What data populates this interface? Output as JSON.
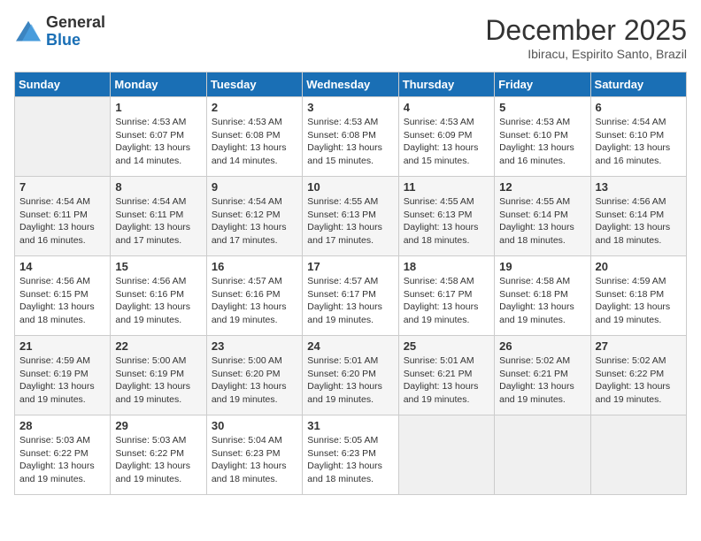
{
  "header": {
    "logo_general": "General",
    "logo_blue": "Blue",
    "month_year": "December 2025",
    "location": "Ibiracu, Espirito Santo, Brazil"
  },
  "weekdays": [
    "Sunday",
    "Monday",
    "Tuesday",
    "Wednesday",
    "Thursday",
    "Friday",
    "Saturday"
  ],
  "weeks": [
    [
      {
        "num": "",
        "sunrise": "",
        "sunset": "",
        "daylight": "",
        "empty": true
      },
      {
        "num": "1",
        "sunrise": "Sunrise: 4:53 AM",
        "sunset": "Sunset: 6:07 PM",
        "daylight": "Daylight: 13 hours and 14 minutes."
      },
      {
        "num": "2",
        "sunrise": "Sunrise: 4:53 AM",
        "sunset": "Sunset: 6:08 PM",
        "daylight": "Daylight: 13 hours and 14 minutes."
      },
      {
        "num": "3",
        "sunrise": "Sunrise: 4:53 AM",
        "sunset": "Sunset: 6:08 PM",
        "daylight": "Daylight: 13 hours and 15 minutes."
      },
      {
        "num": "4",
        "sunrise": "Sunrise: 4:53 AM",
        "sunset": "Sunset: 6:09 PM",
        "daylight": "Daylight: 13 hours and 15 minutes."
      },
      {
        "num": "5",
        "sunrise": "Sunrise: 4:53 AM",
        "sunset": "Sunset: 6:10 PM",
        "daylight": "Daylight: 13 hours and 16 minutes."
      },
      {
        "num": "6",
        "sunrise": "Sunrise: 4:54 AM",
        "sunset": "Sunset: 6:10 PM",
        "daylight": "Daylight: 13 hours and 16 minutes."
      }
    ],
    [
      {
        "num": "7",
        "sunrise": "Sunrise: 4:54 AM",
        "sunset": "Sunset: 6:11 PM",
        "daylight": "Daylight: 13 hours and 16 minutes."
      },
      {
        "num": "8",
        "sunrise": "Sunrise: 4:54 AM",
        "sunset": "Sunset: 6:11 PM",
        "daylight": "Daylight: 13 hours and 17 minutes."
      },
      {
        "num": "9",
        "sunrise": "Sunrise: 4:54 AM",
        "sunset": "Sunset: 6:12 PM",
        "daylight": "Daylight: 13 hours and 17 minutes."
      },
      {
        "num": "10",
        "sunrise": "Sunrise: 4:55 AM",
        "sunset": "Sunset: 6:13 PM",
        "daylight": "Daylight: 13 hours and 17 minutes."
      },
      {
        "num": "11",
        "sunrise": "Sunrise: 4:55 AM",
        "sunset": "Sunset: 6:13 PM",
        "daylight": "Daylight: 13 hours and 18 minutes."
      },
      {
        "num": "12",
        "sunrise": "Sunrise: 4:55 AM",
        "sunset": "Sunset: 6:14 PM",
        "daylight": "Daylight: 13 hours and 18 minutes."
      },
      {
        "num": "13",
        "sunrise": "Sunrise: 4:56 AM",
        "sunset": "Sunset: 6:14 PM",
        "daylight": "Daylight: 13 hours and 18 minutes."
      }
    ],
    [
      {
        "num": "14",
        "sunrise": "Sunrise: 4:56 AM",
        "sunset": "Sunset: 6:15 PM",
        "daylight": "Daylight: 13 hours and 18 minutes."
      },
      {
        "num": "15",
        "sunrise": "Sunrise: 4:56 AM",
        "sunset": "Sunset: 6:16 PM",
        "daylight": "Daylight: 13 hours and 19 minutes."
      },
      {
        "num": "16",
        "sunrise": "Sunrise: 4:57 AM",
        "sunset": "Sunset: 6:16 PM",
        "daylight": "Daylight: 13 hours and 19 minutes."
      },
      {
        "num": "17",
        "sunrise": "Sunrise: 4:57 AM",
        "sunset": "Sunset: 6:17 PM",
        "daylight": "Daylight: 13 hours and 19 minutes."
      },
      {
        "num": "18",
        "sunrise": "Sunrise: 4:58 AM",
        "sunset": "Sunset: 6:17 PM",
        "daylight": "Daylight: 13 hours and 19 minutes."
      },
      {
        "num": "19",
        "sunrise": "Sunrise: 4:58 AM",
        "sunset": "Sunset: 6:18 PM",
        "daylight": "Daylight: 13 hours and 19 minutes."
      },
      {
        "num": "20",
        "sunrise": "Sunrise: 4:59 AM",
        "sunset": "Sunset: 6:18 PM",
        "daylight": "Daylight: 13 hours and 19 minutes."
      }
    ],
    [
      {
        "num": "21",
        "sunrise": "Sunrise: 4:59 AM",
        "sunset": "Sunset: 6:19 PM",
        "daylight": "Daylight: 13 hours and 19 minutes."
      },
      {
        "num": "22",
        "sunrise": "Sunrise: 5:00 AM",
        "sunset": "Sunset: 6:19 PM",
        "daylight": "Daylight: 13 hours and 19 minutes."
      },
      {
        "num": "23",
        "sunrise": "Sunrise: 5:00 AM",
        "sunset": "Sunset: 6:20 PM",
        "daylight": "Daylight: 13 hours and 19 minutes."
      },
      {
        "num": "24",
        "sunrise": "Sunrise: 5:01 AM",
        "sunset": "Sunset: 6:20 PM",
        "daylight": "Daylight: 13 hours and 19 minutes."
      },
      {
        "num": "25",
        "sunrise": "Sunrise: 5:01 AM",
        "sunset": "Sunset: 6:21 PM",
        "daylight": "Daylight: 13 hours and 19 minutes."
      },
      {
        "num": "26",
        "sunrise": "Sunrise: 5:02 AM",
        "sunset": "Sunset: 6:21 PM",
        "daylight": "Daylight: 13 hours and 19 minutes."
      },
      {
        "num": "27",
        "sunrise": "Sunrise: 5:02 AM",
        "sunset": "Sunset: 6:22 PM",
        "daylight": "Daylight: 13 hours and 19 minutes."
      }
    ],
    [
      {
        "num": "28",
        "sunrise": "Sunrise: 5:03 AM",
        "sunset": "Sunset: 6:22 PM",
        "daylight": "Daylight: 13 hours and 19 minutes."
      },
      {
        "num": "29",
        "sunrise": "Sunrise: 5:03 AM",
        "sunset": "Sunset: 6:22 PM",
        "daylight": "Daylight: 13 hours and 19 minutes."
      },
      {
        "num": "30",
        "sunrise": "Sunrise: 5:04 AM",
        "sunset": "Sunset: 6:23 PM",
        "daylight": "Daylight: 13 hours and 18 minutes."
      },
      {
        "num": "31",
        "sunrise": "Sunrise: 5:05 AM",
        "sunset": "Sunset: 6:23 PM",
        "daylight": "Daylight: 13 hours and 18 minutes."
      },
      {
        "num": "",
        "sunrise": "",
        "sunset": "",
        "daylight": "",
        "empty": true
      },
      {
        "num": "",
        "sunrise": "",
        "sunset": "",
        "daylight": "",
        "empty": true
      },
      {
        "num": "",
        "sunrise": "",
        "sunset": "",
        "daylight": "",
        "empty": true
      }
    ]
  ]
}
